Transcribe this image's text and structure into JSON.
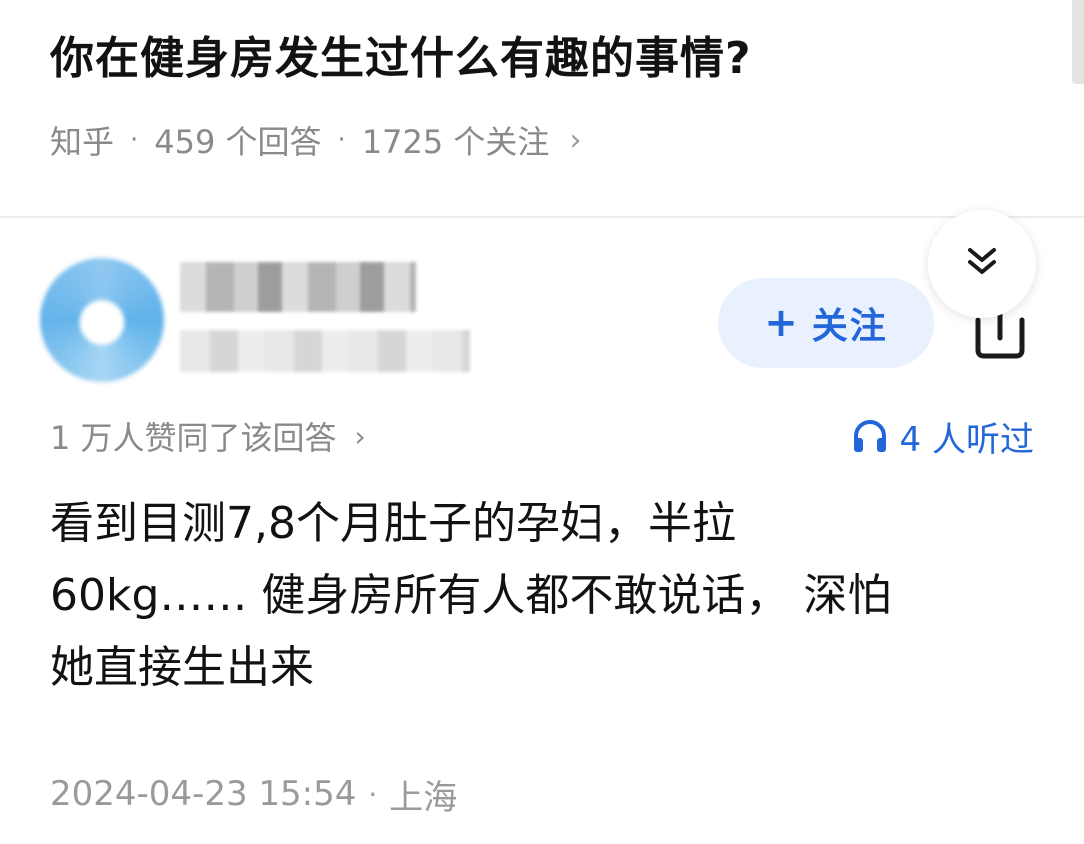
{
  "question": {
    "title": "你在健身房发生过什么有趣的事情?",
    "source": "知乎",
    "answers_count": "459 个回答",
    "followers_count": "1725 个关注",
    "separator": "·",
    "chevron": "›"
  },
  "author": {
    "follow_label": "关注",
    "follow_plus": "+"
  },
  "answer": {
    "votes_text": "1 万人赞同了该回答",
    "votes_chevron": "›",
    "listen_text": "4 人听过",
    "lines": [
      "看到目测7,8个月肚子的孕妇，半拉",
      "60kg…… 健身房所有人都不敢说话， 深怕",
      "她直接生出来"
    ],
    "timestamp": "2024-04-23 15:54",
    "separator": "·",
    "location": "上海"
  },
  "icons": {
    "collapse": "double-chevron-down-icon",
    "share": "share-icon",
    "headphones": "headphones-icon"
  },
  "colors": {
    "accent": "#2266d9",
    "follow_bg": "#e8f1fd",
    "muted_text": "#8a8a8a"
  }
}
